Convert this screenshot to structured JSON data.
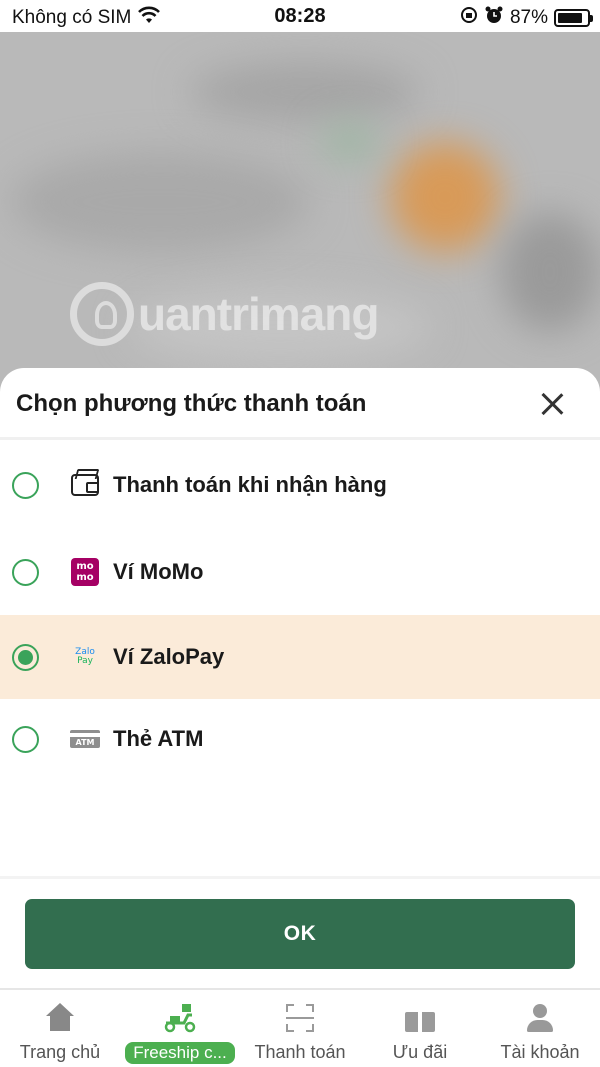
{
  "status_bar": {
    "carrier": "Không có SIM",
    "time": "08:28",
    "battery": "87%",
    "battery_level": 0.87,
    "icons": [
      "wifi-icon",
      "rotation-lock-icon",
      "alarm-icon",
      "battery-icon"
    ]
  },
  "background": {
    "watermark": "uantrimang"
  },
  "payment_sheet": {
    "title": "Chọn phương thức thanh toán",
    "close_icon": "close-icon",
    "options": [
      {
        "label": "Thanh toán khi nhận hàng",
        "icon": "wallet-icon",
        "selected": false
      },
      {
        "label": "Ví MoMo",
        "icon": "momo-icon",
        "icon_text": "mo mo",
        "selected": false
      },
      {
        "label": "Ví ZaloPay",
        "icon": "zalopay-icon",
        "icon_text_top": "Zalo",
        "icon_text_bottom": "Pay",
        "selected": true
      },
      {
        "label": "Thẻ ATM",
        "icon": "atm-card-icon",
        "icon_text": "ATM",
        "selected": false
      }
    ],
    "selected_background": "#fbebd9",
    "radio_color": "#3aa35a",
    "ok_button": "OK",
    "ok_button_color": "#326e4f"
  },
  "bottom_nav": {
    "items": [
      {
        "label": "Trang chủ",
        "icon": "home-icon",
        "active": false
      },
      {
        "label": "Freeship c...",
        "icon": "delivery-scooter-icon",
        "active": true
      },
      {
        "label": "Thanh toán",
        "icon": "scan-icon",
        "active": false
      },
      {
        "label": "Ưu đãi",
        "icon": "gift-icon",
        "active": false
      },
      {
        "label": "Tài khoản",
        "icon": "user-icon",
        "active": false
      }
    ],
    "active_color": "#4caf50"
  }
}
